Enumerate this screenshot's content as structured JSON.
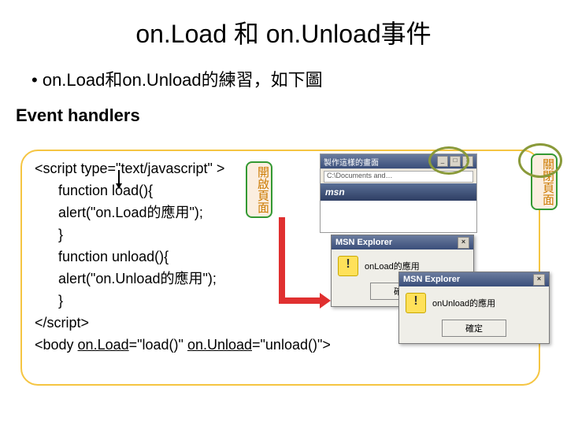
{
  "title": "on.Load 和 on.Unload事件",
  "bullet": "on.Load和on.Unload的練習，如下圖",
  "subhead": "Event handlers",
  "code": {
    "l1a": "<script type=\"text/javascript\" >",
    "l2": "function load(){",
    "l3": "alert(\"on.Load的應用\");",
    "l4": "}",
    "l5": "function unload(){",
    "l6": "alert(\"on.Unload的應用\");",
    "l7": "}",
    "l8": "</script>",
    "l9a": "<body ",
    "l9b": "on.Load",
    "l9c": "=\"load()\" ",
    "l9d": "on.Unload",
    "l9e": "=\"unload()\">"
  },
  "badges": {
    "open": "開啟頁面",
    "close": "關閉頁面"
  },
  "msn": {
    "title": "製作這樣的畫面",
    "addr": "C:\\Documents and…",
    "brand": "msn"
  },
  "alert1": {
    "title": "MSN Explorer",
    "msg": "onLoad的應用",
    "ok": "確定"
  },
  "alert2": {
    "title": "MSN Explorer",
    "msg": "onUnload的應用",
    "ok": "確定"
  }
}
